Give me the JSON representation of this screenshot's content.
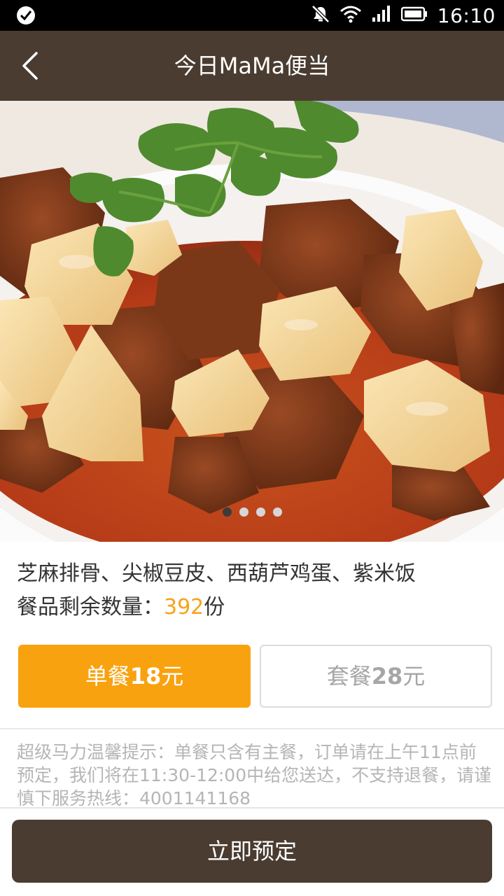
{
  "status_bar": {
    "time": "16:10",
    "icons": [
      "check-circle-icon",
      "mute-icon",
      "wifi-icon",
      "signal-icon",
      "battery-icon"
    ]
  },
  "nav": {
    "title": "今日MaMa便当",
    "back_icon": "chevron-left-icon"
  },
  "carousel": {
    "image": "braised-beef-potato-dish-photo",
    "page_count": 4,
    "active_index": 0
  },
  "meal": {
    "dishes": "芝麻排骨、尖椒豆皮、西葫芦鸡蛋、紫米饭",
    "remaining_label": "餐品剩余数量：",
    "remaining_count": "392",
    "remaining_unit": "份"
  },
  "options": {
    "single": {
      "prefix": "单餐",
      "price": "18",
      "unit": "元"
    },
    "combo": {
      "prefix": "套餐",
      "price": "28",
      "unit": "元"
    }
  },
  "notice": "超级马力温馨提示：单餐只含有主餐，订单请在上午11点前预定，我们将在11:30-12:00中给您送达，不支持退餐，请谨慎下服务热线：4001141168",
  "book_button": "立即预定",
  "colors": {
    "nav_bg": "#4a3c31",
    "accent": "#f9a20f",
    "count": "#f8a21a",
    "notice_text": "#b5b5b5"
  }
}
